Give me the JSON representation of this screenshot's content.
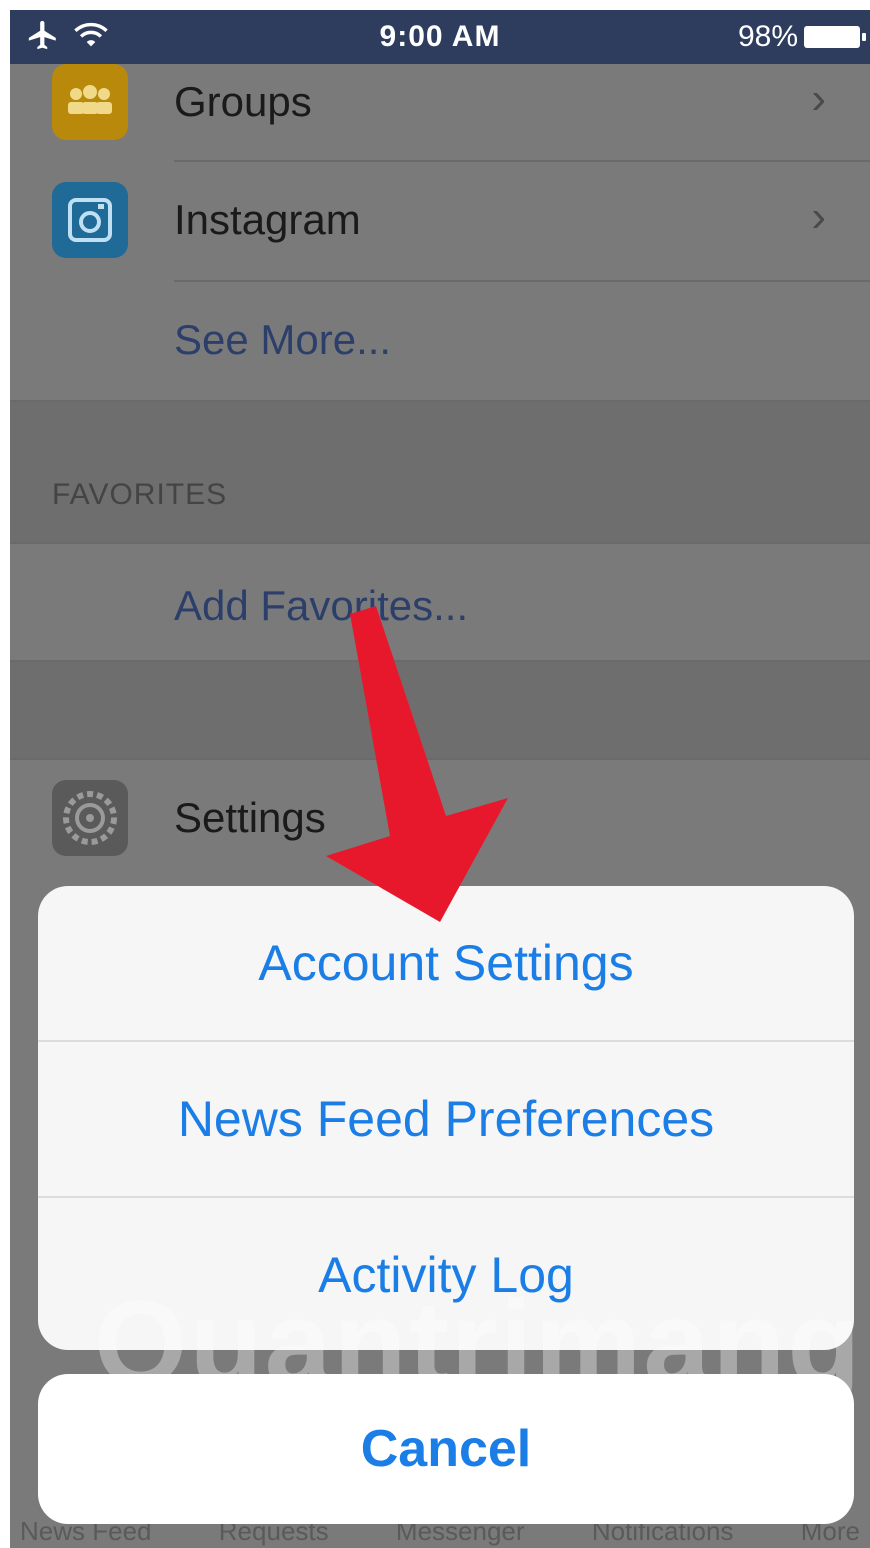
{
  "status_bar": {
    "time": "9:00 AM",
    "battery": "98%",
    "icons": [
      "airplane-icon",
      "wifi-icon",
      "battery-icon"
    ]
  },
  "menu": {
    "groups_label": "Groups",
    "instagram_label": "Instagram",
    "see_more_label": "See More...",
    "favorites_header": "FAVORITES",
    "add_favorites_label": "Add Favorites...",
    "settings_label": "Settings"
  },
  "action_sheet": {
    "options": [
      "Account Settings",
      "News Feed Preferences",
      "Activity Log"
    ],
    "cancel_label": "Cancel"
  },
  "tab_bar": {
    "items": [
      "News Feed",
      "Requests",
      "Messenger",
      "Notifications",
      "More"
    ]
  },
  "watermark": "Quantrimang",
  "colors": {
    "status_bar": "#2e3d5e",
    "ios_blue": "#1a7ee6",
    "groups_icon": "#b8890a",
    "instagram_icon": "#1f6a96",
    "settings_icon": "#5a5a5a",
    "arrow": "#e8182c"
  }
}
